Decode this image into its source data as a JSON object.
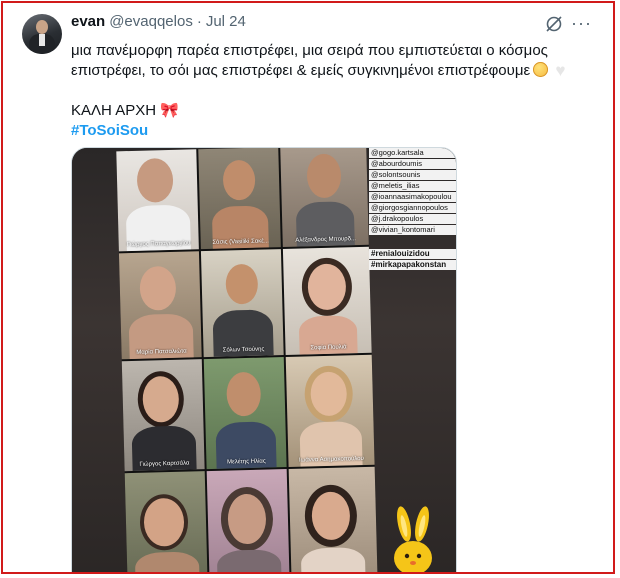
{
  "tweet": {
    "author_name": "evan",
    "handle": "@evaqqelos",
    "separator": "·",
    "date": "Jul 24",
    "more_label": "···",
    "text_line1": "μια πανέμορφη παρέα επιστρέφει, μια σειρά που εμπιστεύεται ο κόσμος",
    "text_line2": "επιστρέφει, το σόι μας επιστρέφει & εμείς συγκινημένοι επιστρέφουμε",
    "heading": "ΚΑΛΗ ΑΡΧΗ",
    "bow_emoji": "🎀",
    "heart_emoji": "♥",
    "hashtag": "#ToSoiSou"
  },
  "media": {
    "captions": [
      "Γιώργος Παπαγεωργίου",
      "Σάσις (Vasiliki Σακέ...",
      "Αλέξανδρος Μπουρδ...",
      "Μαρία Πατσαλιώτα",
      "Σόλων Τσούνης",
      "Σοφία Πουλιά",
      "Γιώργος Καρτσάλα",
      "Μελέτης Ηλίας",
      "Ιωάννα Ασημακοπούλου",
      "",
      "",
      ""
    ],
    "tags": [
      "@gogo.kartsala",
      "@abourdoumis",
      "@solontsounis",
      "@meletis_ilias",
      "@ioannaasimakopoulou",
      "@giorgosgiannopoulos",
      "@j.drakopoulos",
      "@vivian_kontomari",
      "#renialouizidou",
      "#mirkapapakonstan"
    ]
  },
  "colors": {
    "accent": "#1d9bf0",
    "frame": "#d11a1a",
    "muted": "#536471"
  }
}
